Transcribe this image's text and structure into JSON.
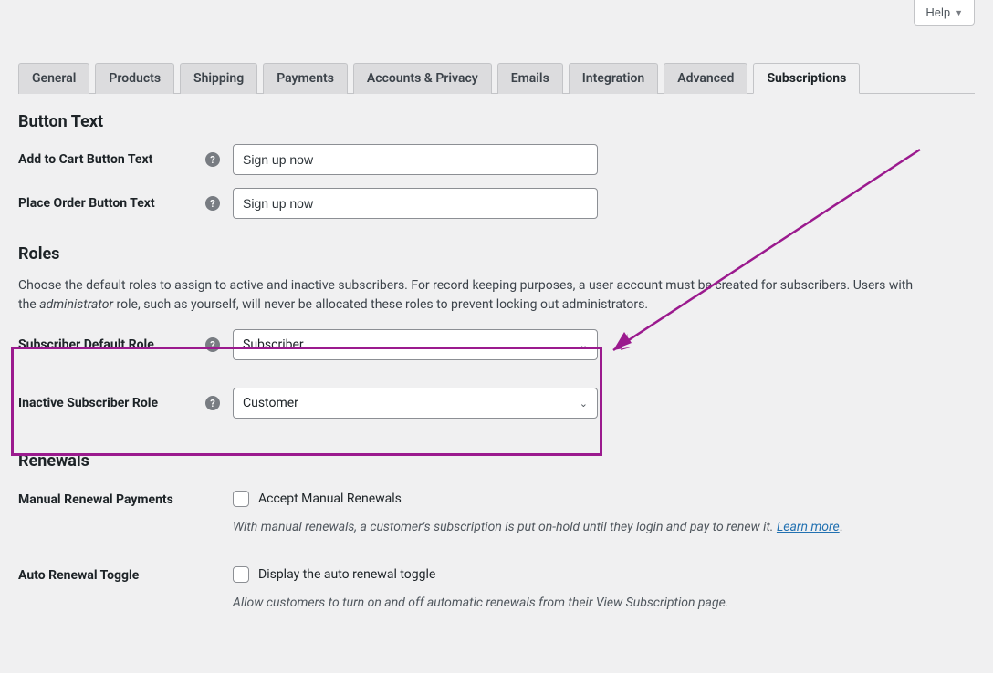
{
  "help_button": "Help",
  "tabs": [
    {
      "label": "General"
    },
    {
      "label": "Products"
    },
    {
      "label": "Shipping"
    },
    {
      "label": "Payments"
    },
    {
      "label": "Accounts & Privacy"
    },
    {
      "label": "Emails"
    },
    {
      "label": "Integration"
    },
    {
      "label": "Advanced"
    },
    {
      "label": "Subscriptions"
    }
  ],
  "sections": {
    "button_text": {
      "heading": "Button Text",
      "add_to_cart": {
        "label": "Add to Cart Button Text",
        "value": "Sign up now"
      },
      "place_order": {
        "label": "Place Order Button Text",
        "value": "Sign up now"
      }
    },
    "roles": {
      "heading": "Roles",
      "desc_1": "Choose the default roles to assign to active and inactive subscribers. For record keeping purposes, a user account must be created for subscribers. Users with the ",
      "desc_role": "administrator",
      "desc_2": " role, such as yourself, will never be allocated these roles to prevent locking out administrators.",
      "default_role": {
        "label": "Subscriber Default Role",
        "value": "Subscriber"
      },
      "inactive_role": {
        "label": "Inactive Subscriber Role",
        "value": "Customer"
      }
    },
    "renewals": {
      "heading": "Renewals",
      "manual": {
        "label": "Manual Renewal Payments",
        "checkbox_label": "Accept Manual Renewals",
        "desc": "With manual renewals, a customer's subscription is put on-hold until they login and pay to renew it. ",
        "learn_more": "Learn more",
        "period": "."
      },
      "auto_toggle": {
        "label": "Auto Renewal Toggle",
        "checkbox_label": "Display the auto renewal toggle",
        "desc": "Allow customers to turn on and off automatic renewals from their View Subscription page."
      }
    }
  },
  "annotation_color": "#9b1a8e"
}
